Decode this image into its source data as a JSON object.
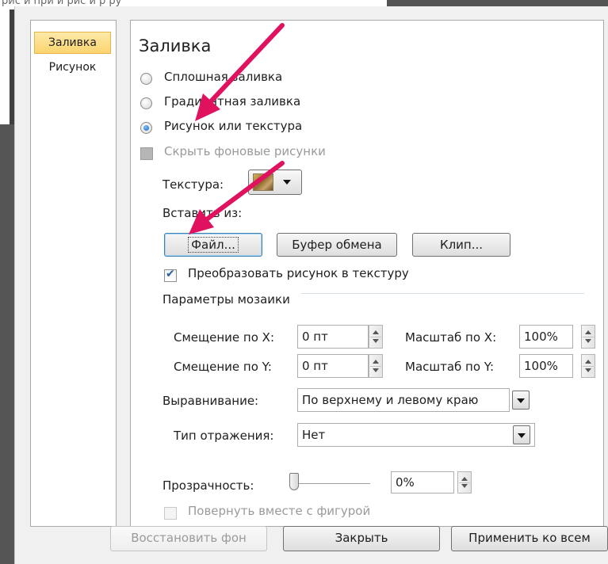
{
  "background": {
    "top_text": "рис и при и рис и р  ру"
  },
  "sidebar": {
    "items": [
      {
        "label": "Заливка",
        "selected": true
      },
      {
        "label": "Рисунок",
        "selected": false
      }
    ]
  },
  "fill": {
    "title": "Заливка",
    "options": [
      {
        "label": "Сплошная заливка",
        "checked": false
      },
      {
        "label": "Градиентная заливка",
        "checked": false
      },
      {
        "label": "Рисунок или текстура",
        "checked": true
      }
    ],
    "hide_bg_label": "Скрыть фоновые рисунки",
    "texture_label": "Текстура:",
    "insert_from_label": "Вставить из:",
    "buttons": {
      "file": "Файл...",
      "clipboard": "Буфер обмена",
      "clip": "Клип..."
    },
    "tile_checkbox_label": "Преобразовать рисунок в текстуру",
    "tiling": {
      "group_label": "Параметры мозаики",
      "offset_x_label": "Смещение по X:",
      "offset_x_value": "0 пт",
      "offset_y_label": "Смещение по Y:",
      "offset_y_value": "0 пт",
      "scale_x_label": "Масштаб по X:",
      "scale_x_value": "100%",
      "scale_y_label": "Масштаб по Y:",
      "scale_y_value": "100%",
      "align_label": "Выравнивание:",
      "align_value": "По верхнему и левому краю",
      "mirror_label": "Тип отражения:",
      "mirror_value": "Нет"
    },
    "transparency_label": "Прозрачность:",
    "transparency_value": "0%",
    "transparency_level": 0,
    "rotate_label": "Повернуть вместе с фигурой"
  },
  "footer": {
    "reset": "Восстановить фон",
    "close": "Закрыть",
    "apply_all": "Применить ко всем"
  },
  "colors": {
    "annotation_arrow": "#e0115f",
    "selected_tab": "#fbd46f"
  }
}
